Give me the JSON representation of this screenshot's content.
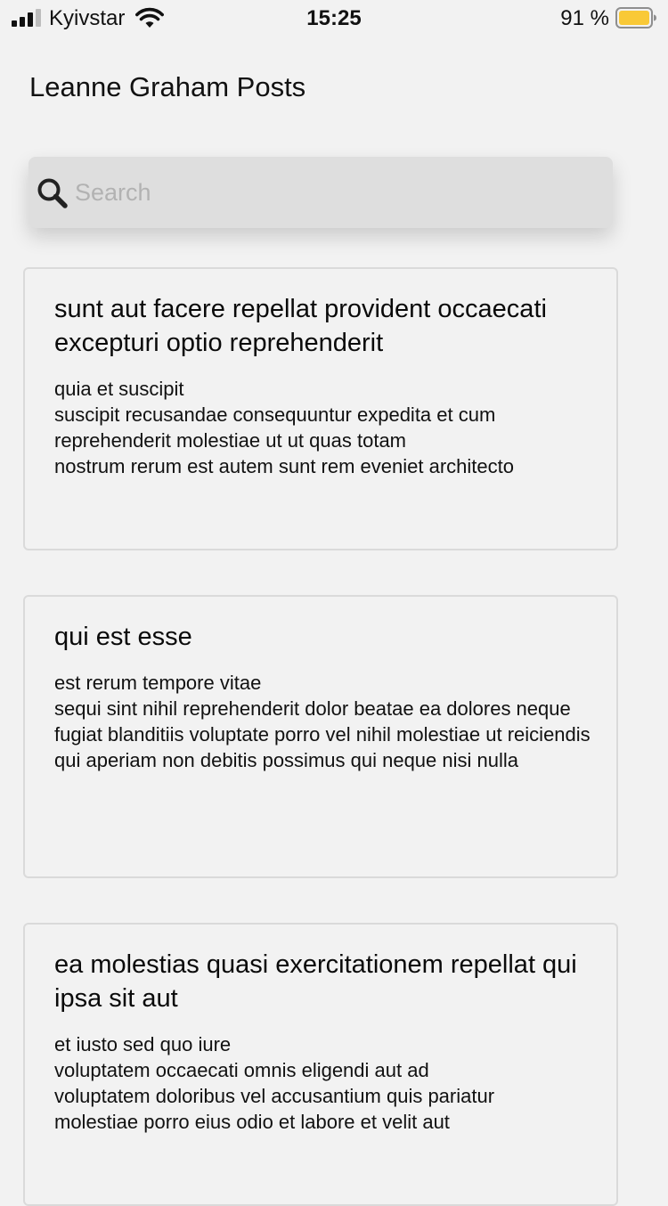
{
  "status_bar": {
    "carrier": "Kyivstar",
    "time": "15:25",
    "battery_percent": "91 %",
    "battery_color": "#f9c937"
  },
  "header": {
    "title": "Leanne Graham Posts"
  },
  "search": {
    "placeholder": "Search",
    "value": "",
    "icon": "search-icon"
  },
  "posts": [
    {
      "title": "sunt aut facere repellat provident occaecati excepturi optio reprehenderit",
      "body": "quia et suscipit\nsuscipit recusandae consequuntur expedita et cum\nreprehenderit molestiae ut ut quas totam\nnostrum rerum est autem sunt rem eveniet architecto"
    },
    {
      "title": "qui est esse",
      "body": "est rerum tempore vitae\nsequi sint nihil reprehenderit dolor beatae ea dolores neque\nfugiat blanditiis voluptate porro vel nihil molestiae ut reiciendis\nqui aperiam non debitis possimus qui neque nisi nulla"
    },
    {
      "title": "ea molestias quasi exercitationem repellat qui ipsa sit aut",
      "body": "et iusto sed quo iure\nvoluptatem occaecati omnis eligendi aut ad\nvoluptatem doloribus vel accusantium quis pariatur\nmolestiae porro eius odio et labore et velit aut"
    }
  ]
}
